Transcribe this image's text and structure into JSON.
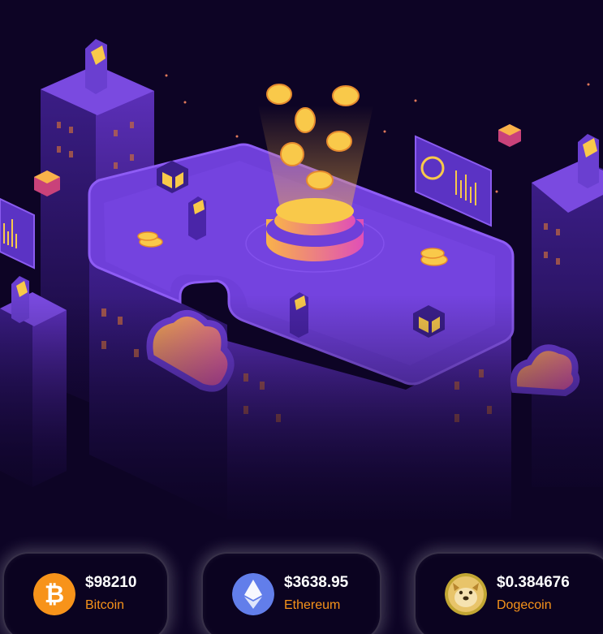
{
  "colors": {
    "background": "#0d0425",
    "platform": "#6f3fd9",
    "accent_orange": "#f7931a",
    "accent_pink": "#e04fb8"
  },
  "coins": [
    {
      "icon": "bitcoin-icon",
      "price": "$98210",
      "name": "Bitcoin",
      "icon_color": "#f7931a"
    },
    {
      "icon": "ethereum-icon",
      "price": "$3638.95",
      "name": "Ethereum",
      "icon_color": "#627eea"
    },
    {
      "icon": "dogecoin-icon",
      "price": "$0.384676",
      "name": "Dogecoin",
      "icon_color": "#c2a633"
    }
  ]
}
